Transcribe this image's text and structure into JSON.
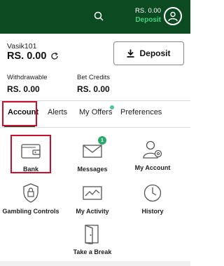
{
  "header": {
    "balance_amount": "RS. 0.00",
    "deposit_label": "Deposit",
    "icons": [
      "search-icon",
      "user-icon"
    ]
  },
  "account": {
    "username": "Vasik101",
    "balance": "RS. 0.00",
    "deposit_button": "Deposit",
    "withdrawable_label": "Withdrawable",
    "withdrawable_value": "RS. 0.00",
    "bet_credits_label": "Bet Credits",
    "bet_credits_value": "RS. 0.00"
  },
  "tabs": [
    {
      "label": "Account",
      "active": true
    },
    {
      "label": "Alerts",
      "active": false
    },
    {
      "label": "My Offers",
      "active": false,
      "has_dot": true
    },
    {
      "label": "Preferences",
      "active": false
    }
  ],
  "menu": [
    {
      "label": "Bank",
      "icon": "wallet-icon"
    },
    {
      "label": "Messages",
      "icon": "envelope-icon",
      "badge": "1"
    },
    {
      "label": "My Account",
      "icon": "user-gear-icon"
    },
    {
      "label": "Gambling Controls",
      "icon": "shield-lock-icon"
    },
    {
      "label": "My Activity",
      "icon": "activity-chart-icon"
    },
    {
      "label": "History",
      "icon": "clock-icon"
    },
    {
      "label": "Take a Break",
      "icon": "door-exit-icon"
    }
  ],
  "colors": {
    "header_bg": "#0c4a22",
    "deposit_green": "#3fd07a",
    "highlight_red": "#c8102e",
    "badge_green": "#2aa86a"
  }
}
